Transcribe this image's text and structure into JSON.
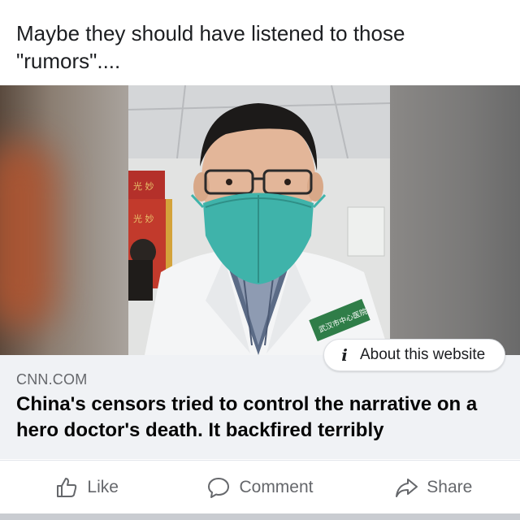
{
  "post": {
    "text": "Maybe they should have listened to those \"rumors\"...."
  },
  "link": {
    "about_label": "About this website",
    "domain": "CNN.COM",
    "headline": "China's censors tried to control the narrative on a hero doctor's death. It backfired terribly"
  },
  "actions": {
    "like": "Like",
    "comment": "Comment",
    "share": "Share"
  },
  "icons": {
    "info": "info-icon",
    "like": "thumbs-up-icon",
    "comment": "speech-bubble-icon",
    "share": "share-arrow-icon"
  },
  "colors": {
    "text": "#1c1e21",
    "secondary": "#65676b",
    "link_background": "#f0f2f5",
    "mask": "#3fb3aa"
  }
}
